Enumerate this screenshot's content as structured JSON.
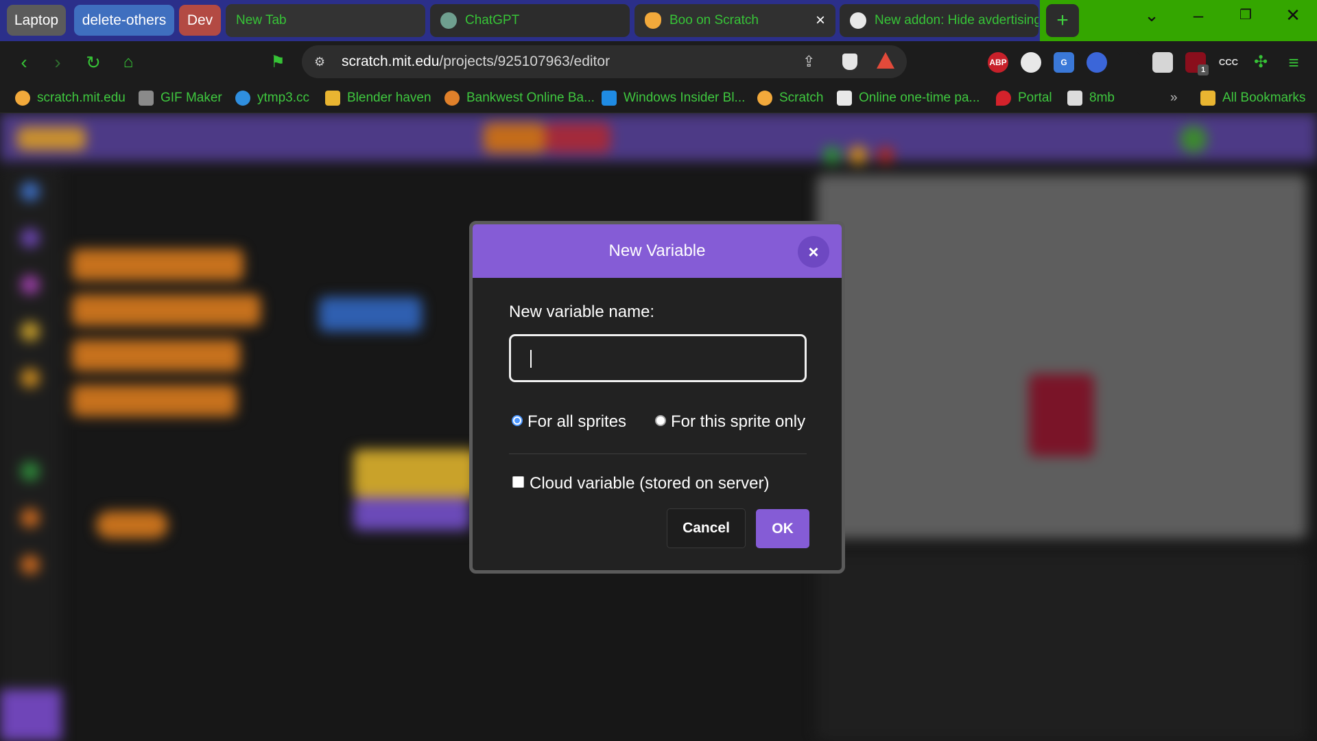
{
  "tab_groups": [
    "Laptop",
    "delete-others",
    "Dev"
  ],
  "tabs": [
    {
      "title": "New Tab",
      "icon": "blank-tab-icon"
    },
    {
      "title": "ChatGPT",
      "icon": "chatgpt-icon"
    },
    {
      "title": "Boo on Scratch",
      "icon": "scratch-cat-icon",
      "active": true
    },
    {
      "title": "New addon: Hide avdertising",
      "icon": "github-icon"
    }
  ],
  "address_bar": {
    "host": "scratch.mit.edu",
    "path": "/projects/925107963/editor"
  },
  "extensions_badge": "1",
  "bookmarks": [
    "scratch.mit.edu",
    "GIF Maker",
    "ytmp3.cc",
    "Blender haven",
    "Bankwest Online Ba...",
    "Windows Insider Bl...",
    "Scratch",
    "Online one-time pa...",
    "Portal",
    "8mb"
  ],
  "bookmarks_overflow": "»",
  "all_bookmarks": "All Bookmarks",
  "dialog": {
    "title": "New Variable",
    "close_glyph": "×",
    "name_label": "New variable name:",
    "name_value": "",
    "scope_options": [
      {
        "label": "For all sprites",
        "selected": true
      },
      {
        "label": "For this sprite only",
        "selected": false
      }
    ],
    "cloud_label": "Cloud variable (stored on server)",
    "cloud_checked": false,
    "cancel_label": "Cancel",
    "ok_label": "OK"
  },
  "colors": {
    "accent": "#855cd6",
    "browser_accent": "#34a600",
    "radio_selected": "#4c97ff"
  }
}
